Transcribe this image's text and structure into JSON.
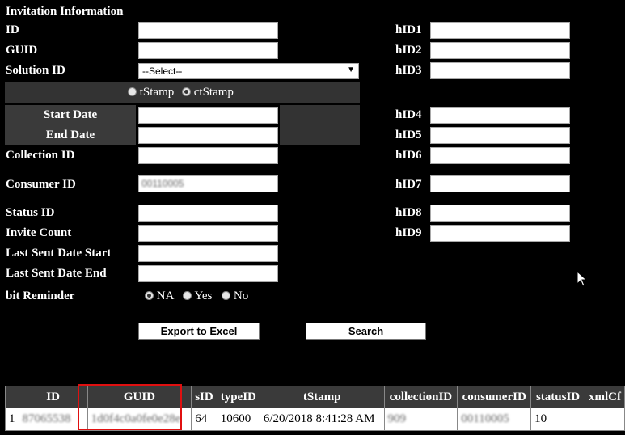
{
  "section_title": "Invitation Information",
  "form": {
    "id_label": "ID",
    "guid_label": "GUID",
    "solution_id_label": "Solution ID",
    "solution_id_selected": "--Select--",
    "timestamp_options": [
      "tStamp",
      "ctStamp"
    ],
    "timestamp_selected": "ctStamp",
    "start_date_label": "Start Date",
    "end_date_label": "End Date",
    "collection_id_label": "Collection ID",
    "consumer_id_label": "Consumer ID",
    "consumer_id_value": "00110005",
    "status_id_label": "Status ID",
    "invite_count_label": "Invite Count",
    "last_sent_start_label": "Last Sent Date Start",
    "last_sent_end_label": "Last Sent Date End",
    "bit_reminder_label": "bit Reminder",
    "bit_reminder_options": [
      "NA",
      "Yes",
      "No"
    ],
    "bit_reminder_selected": "NA",
    "hid_labels": [
      "hID1",
      "hID2",
      "hID3",
      "hID4",
      "hID5",
      "hID6",
      "hID7",
      "hID8",
      "hID9"
    ]
  },
  "buttons": {
    "export": "Export to Excel",
    "search": "Search"
  },
  "results": {
    "columns": [
      "",
      "ID",
      "GUID",
      "sID",
      "typeID",
      "tStamp",
      "collectionID",
      "consumerID",
      "statusID",
      "xmlCf"
    ],
    "rows": [
      {
        "index": "1",
        "id": "87065538",
        "guid": "1d0f4c0a0fe0e28e",
        "sid": "64",
        "typeid": "10600",
        "tstamp": "6/20/2018 8:41:28 AM",
        "collectionid": "909",
        "consumerid": "00110005",
        "statusid": "10",
        "xmlcf": ""
      }
    ]
  },
  "colors": {
    "background": "#000000",
    "header_bar": "#333333",
    "highlight": "#e01010"
  }
}
